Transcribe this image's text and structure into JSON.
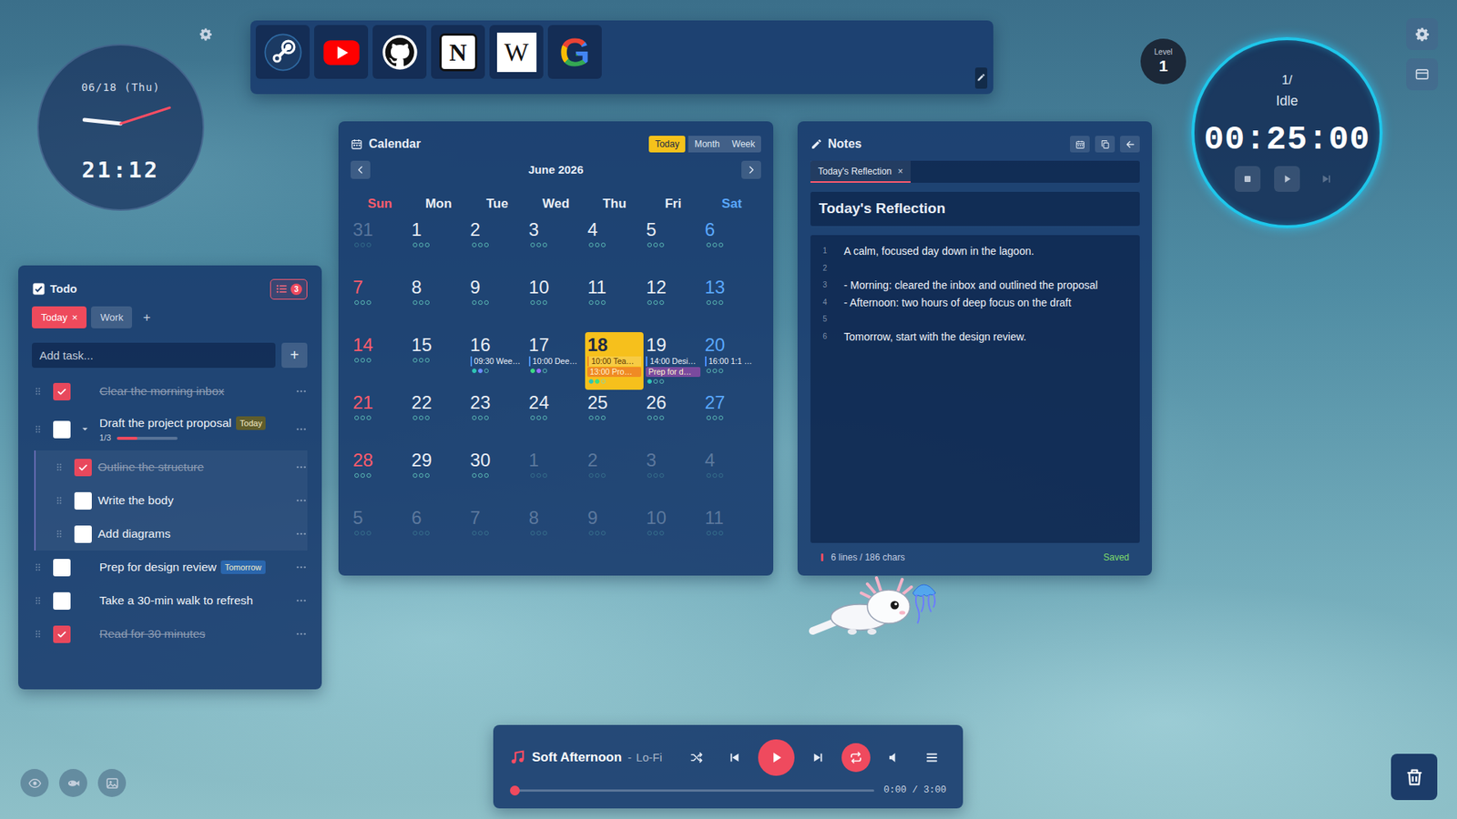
{
  "clock": {
    "date": "06/18 (Thu)",
    "time": "21:12"
  },
  "launcher": {
    "items": [
      {
        "kind": "steam"
      },
      {
        "kind": "youtube"
      },
      {
        "kind": "github"
      },
      {
        "kind": "notion",
        "glyph": "N"
      },
      {
        "kind": "wikipedia",
        "glyph": "W"
      },
      {
        "kind": "google",
        "glyph": "G"
      }
    ]
  },
  "calendar": {
    "title": "Calendar",
    "buttons": [
      {
        "label": "Today",
        "selected": true
      },
      {
        "label": "Month",
        "selected": false
      },
      {
        "label": "Week",
        "selected": false
      }
    ],
    "month": "June 2026",
    "weekdays": [
      {
        "label": "Sun",
        "color": "#ff5c6c"
      },
      {
        "label": "Mon",
        "color": "#e9eef5"
      },
      {
        "label": "Tue",
        "color": "#e9eef5"
      },
      {
        "label": "Wed",
        "color": "#e9eef5"
      },
      {
        "label": "Thu",
        "color": "#e9eef5"
      },
      {
        "label": "Fri",
        "color": "#e9eef5"
      },
      {
        "label": "Sat",
        "color": "#5aa8ff"
      }
    ],
    "weeks": [
      [
        {
          "day": "31",
          "muted": true,
          "today": false
        },
        {
          "day": "1",
          "muted": false,
          "today": false
        },
        {
          "day": "2",
          "muted": false,
          "today": false
        },
        {
          "day": "3",
          "muted": false,
          "today": false
        },
        {
          "day": "4",
          "muted": false,
          "today": false
        },
        {
          "day": "5",
          "muted": false,
          "today": false
        },
        {
          "day": "6",
          "muted": false,
          "today": false
        }
      ],
      [
        {
          "day": "7",
          "muted": false,
          "today": false
        },
        {
          "day": "8",
          "muted": false,
          "today": false
        },
        {
          "day": "9",
          "muted": false,
          "today": false
        },
        {
          "day": "10",
          "muted": false,
          "today": false
        },
        {
          "day": "11",
          "muted": false,
          "today": false
        },
        {
          "day": "12",
          "muted": false,
          "today": false
        },
        {
          "day": "13",
          "muted": false,
          "today": false
        }
      ],
      [
        {
          "day": "14",
          "muted": false,
          "today": false
        },
        {
          "day": "15",
          "muted": false,
          "today": false
        },
        {
          "day": "16",
          "muted": false,
          "today": false,
          "events": [
            {
              "text": "09:30 Wee…",
              "kind": "bar",
              "color": "#4a90ff"
            }
          ],
          "dots": [
            "#2ec4b6",
            "#6c8cff"
          ]
        },
        {
          "day": "17",
          "muted": false,
          "today": false,
          "events": [
            {
              "text": "10:00 Dee…",
              "kind": "bar",
              "color": "#4a90ff"
            }
          ],
          "dots": [
            "#3ddc84",
            "#9b6cff"
          ]
        },
        {
          "day": "18",
          "muted": false,
          "today": true,
          "events": [
            {
              "text": "10:00 Tea…",
              "kind": "bar",
              "color": "#f08a24"
            },
            {
              "text": "13:00 Pro…",
              "kind": "block",
              "color": "#f08a24"
            }
          ],
          "dots": [
            "#2ec4b6",
            "#3ddc84"
          ]
        },
        {
          "day": "19",
          "muted": false,
          "today": false,
          "events": [
            {
              "text": "14:00 Desi…",
              "kind": "bar",
              "color": "#4a90ff"
            },
            {
              "text": "Prep for d…",
              "kind": "block",
              "color": "#7a4a9e"
            }
          ],
          "dots": [
            "#2ec4b6"
          ]
        },
        {
          "day": "20",
          "muted": false,
          "today": false,
          "events": [
            {
              "text": "16:00 1:1 …",
              "kind": "bar",
              "color": "#4a90ff"
            }
          ],
          "dots": []
        }
      ],
      [
        {
          "day": "21",
          "muted": false,
          "today": false
        },
        {
          "day": "22",
          "muted": false,
          "today": false
        },
        {
          "day": "23",
          "muted": false,
          "today": false
        },
        {
          "day": "24",
          "muted": false,
          "today": false
        },
        {
          "day": "25",
          "muted": false,
          "today": false
        },
        {
          "day": "26",
          "muted": false,
          "today": false
        },
        {
          "day": "27",
          "muted": false,
          "today": false
        }
      ],
      [
        {
          "day": "28",
          "muted": false,
          "today": false
        },
        {
          "day": "29",
          "muted": false,
          "today": false
        },
        {
          "day": "30",
          "muted": false,
          "today": false
        },
        {
          "day": "1",
          "muted": true,
          "today": false
        },
        {
          "day": "2",
          "muted": true,
          "today": false
        },
        {
          "day": "3",
          "muted": true,
          "today": false
        },
        {
          "day": "4",
          "muted": true,
          "today": false
        }
      ],
      [
        {
          "day": "5",
          "muted": true,
          "today": false
        },
        {
          "day": "6",
          "muted": true,
          "today": false
        },
        {
          "day": "7",
          "muted": true,
          "today": false
        },
        {
          "day": "8",
          "muted": true,
          "today": false
        },
        {
          "day": "9",
          "muted": true,
          "today": false
        },
        {
          "day": "10",
          "muted": true,
          "today": false
        },
        {
          "day": "11",
          "muted": true,
          "today": false
        }
      ]
    ]
  },
  "todo": {
    "title": "Todo",
    "count": "3",
    "tabs": [
      {
        "label": "Today",
        "selected": true,
        "close": "×"
      },
      {
        "label": "Work",
        "selected": false
      }
    ],
    "add_tab": "+",
    "input": {
      "placeholder": "Add task..."
    },
    "add_button": "+",
    "tasks": [
      {
        "text": "Clear the morning inbox",
        "checked": true
      },
      {
        "text": "Draft the project proposal",
        "checked": false,
        "expanded": true,
        "tag": {
          "text": "Today",
          "color": "#5f5d2c"
        },
        "progress": {
          "text": "1/3",
          "level": 0.333
        },
        "subtasks": [
          {
            "text": "Outline the structure",
            "checked": true
          },
          {
            "text": "Write the body",
            "checked": false
          },
          {
            "text": "Add diagrams",
            "checked": false
          }
        ]
      },
      {
        "text": "Prep for design review",
        "checked": false,
        "tag": {
          "text": "Tomorrow",
          "color": "#2a66ad"
        }
      },
      {
        "text": "Take a 30-min walk to refresh",
        "checked": false
      },
      {
        "text": "Read for 30 minutes",
        "checked": true
      }
    ]
  },
  "notes": {
    "title": "Notes",
    "tab": {
      "label": "Today's Reflection",
      "close": "×",
      "selected": true
    },
    "heading": "Today's Reflection",
    "lines": [
      {
        "num": "1",
        "text": "A calm, focused day down in the lagoon."
      },
      {
        "num": "2",
        "text": ""
      },
      {
        "num": "3",
        "text": "- Morning: cleared the inbox and outlined the proposal"
      },
      {
        "num": "4",
        "text": "- Afternoon: two hours of deep focus on the draft"
      },
      {
        "num": "5",
        "text": ""
      },
      {
        "num": "6",
        "text": "Tomorrow, start with the design review."
      }
    ],
    "footer": {
      "stats": "6 lines / 186 chars",
      "status": "Saved"
    }
  },
  "level": {
    "label": "Level",
    "value": "1"
  },
  "timer": {
    "session": "1/",
    "state": "Idle",
    "time": "00:25:00",
    "controls": [
      {
        "kind": "stop",
        "disabled": false
      },
      {
        "kind": "play",
        "disabled": false
      },
      {
        "kind": "skip",
        "disabled": true
      }
    ]
  },
  "player": {
    "title": "Soft Afternoon",
    "separator": "-",
    "genre": "Lo-Fi",
    "controls": [
      {
        "kind": "shuffle",
        "on": false
      },
      {
        "kind": "prev",
        "on": false
      },
      {
        "kind": "play",
        "on": true
      },
      {
        "kind": "next",
        "on": false
      },
      {
        "kind": "repeat",
        "on": true
      },
      {
        "kind": "volume",
        "on": false
      },
      {
        "kind": "playlist",
        "on": false
      }
    ],
    "progress": {
      "level": 0,
      "text": "0:00 / 3:00"
    }
  },
  "toolbar": {
    "items": [
      {
        "kind": "eye"
      },
      {
        "kind": "fish"
      },
      {
        "kind": "image"
      }
    ]
  },
  "side_buttons": {
    "items": [
      {
        "kind": "settings"
      },
      {
        "kind": "panel"
      }
    ]
  }
}
